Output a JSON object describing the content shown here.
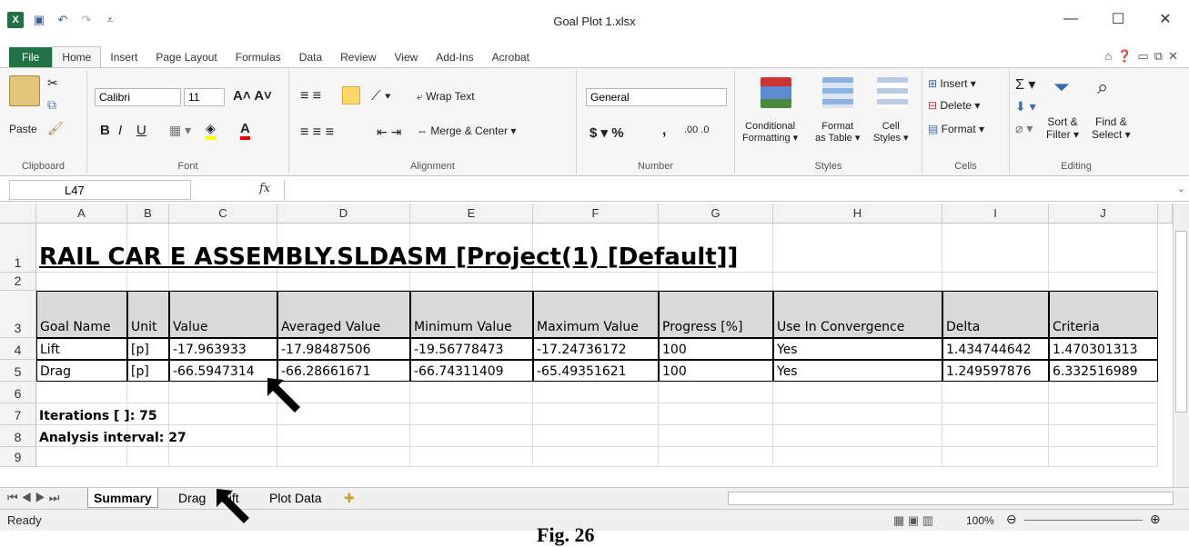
{
  "window": {
    "title": "Goal Plot 1.xlsx",
    "minimize": "—",
    "maximize": "☐",
    "close": "✕"
  },
  "tabs": [
    "File",
    "Home",
    "Insert",
    "Page Layout",
    "Formulas",
    "Data",
    "Review",
    "View",
    "Add-Ins",
    "Acrobat"
  ],
  "ribbon": {
    "clipboard": {
      "paste": "Paste",
      "label": "Clipboard"
    },
    "font": {
      "name": "Calibri",
      "size": "11",
      "label": "Font",
      "bold": "B",
      "italic": "I",
      "underline": "U"
    },
    "alignment": {
      "wrap": "Wrap Text",
      "merge": "Merge & Center ▾",
      "label": "Alignment"
    },
    "number": {
      "format": "General",
      "currency": "$ ▾ %",
      "comma": ",",
      "dec": ".00 .0",
      "label": "Number"
    },
    "styles": {
      "conditional": "Conditional",
      "conditional2": "Formatting ▾",
      "format_table": "Format",
      "format_table2": "as Table ▾",
      "cell_styles": "Cell",
      "cell_styles2": "Styles ▾",
      "label": "Styles"
    },
    "cells": {
      "insert": "Insert ▾",
      "delete": "Delete ▾",
      "format": "Format ▾",
      "label": "Cells"
    },
    "editing": {
      "sort": "Sort &",
      "sort2": "Filter ▾",
      "find": "Find &",
      "find2": "Select ▾",
      "label": "Editing"
    }
  },
  "formula_bar": {
    "name_box": "L47",
    "fx": "fx",
    "content": ""
  },
  "columns": [
    "A",
    "B",
    "C",
    "D",
    "E",
    "F",
    "G",
    "H",
    "I",
    "J"
  ],
  "rows": [
    "1",
    "2",
    "3",
    "4",
    "5",
    "6",
    "7",
    "8",
    "9"
  ],
  "sheet": {
    "title": "RAIL CAR E ASSEMBLY.SLDASM [Project(1) [Default]]",
    "headers": [
      "Goal Name",
      "Unit",
      "Value",
      "Averaged Value",
      "Minimum Value",
      "Maximum Value",
      "Progress [%]",
      "Use In Convergence",
      "Delta",
      "Criteria"
    ],
    "data": [
      [
        "Lift",
        "[p]",
        "-17.963933",
        "-17.98487506",
        "-19.56778473",
        "-17.24736172",
        "100",
        "Yes",
        "1.434744642",
        "1.470301313"
      ],
      [
        "Drag",
        "[p]",
        "-66.5947314",
        "-66.28661671",
        "-66.74311409",
        "-65.49351621",
        "100",
        "Yes",
        "1.249597876",
        "6.332516989"
      ]
    ],
    "iterations": "Iterations [ ]: 75",
    "analysis": "Analysis interval: 27"
  },
  "sheet_tabs": [
    "Summary",
    "Drag",
    "Lift",
    "Plot Data"
  ],
  "status": {
    "ready": "Ready",
    "zoom": "100%"
  },
  "caption": "Fig. 26"
}
